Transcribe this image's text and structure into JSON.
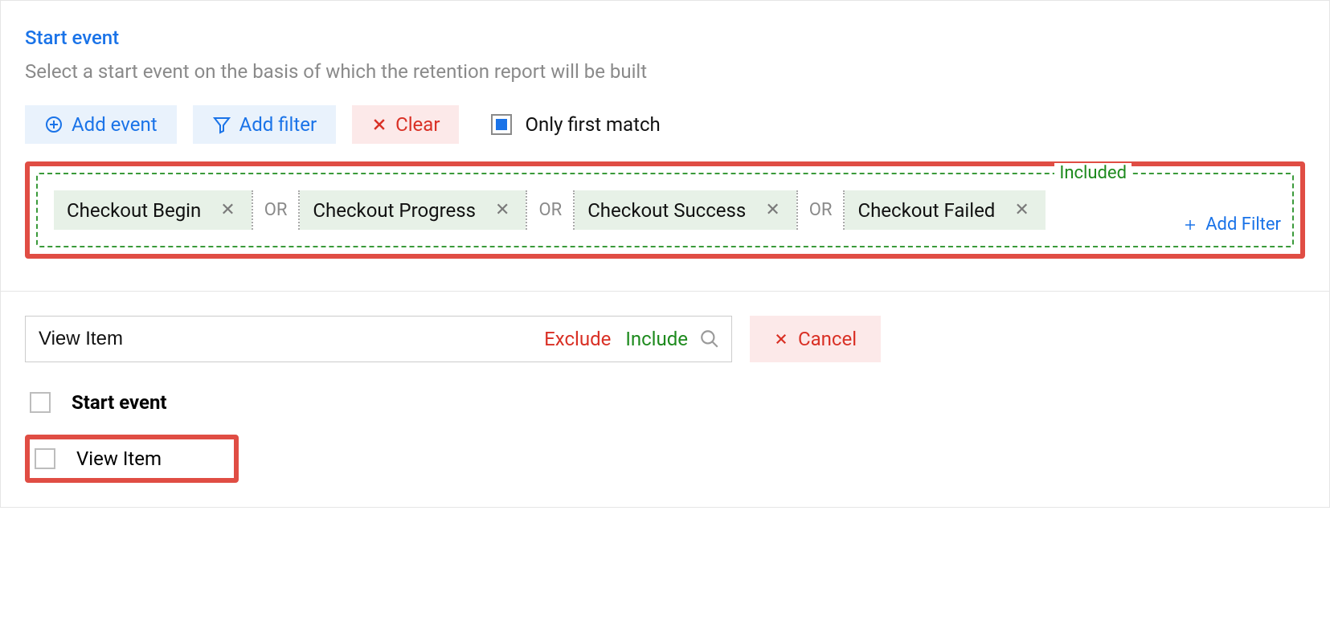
{
  "header": {
    "title": "Start event",
    "description": "Select a start event on the basis of which the retention report will be built"
  },
  "toolbar": {
    "add_event": "Add event",
    "add_filter": "Add filter",
    "clear": "Clear",
    "only_first_match": "Only first match"
  },
  "included_box": {
    "legend": "Included",
    "add_filter": "Add Filter",
    "separator": "OR",
    "chips": [
      "Checkout Begin",
      "Checkout Progress",
      "Checkout Success",
      "Checkout Failed"
    ]
  },
  "search": {
    "value": "View Item",
    "exclude": "Exclude",
    "include": "Include",
    "cancel": "Cancel"
  },
  "list": {
    "header": "Start event",
    "rows": [
      "View Item"
    ]
  }
}
